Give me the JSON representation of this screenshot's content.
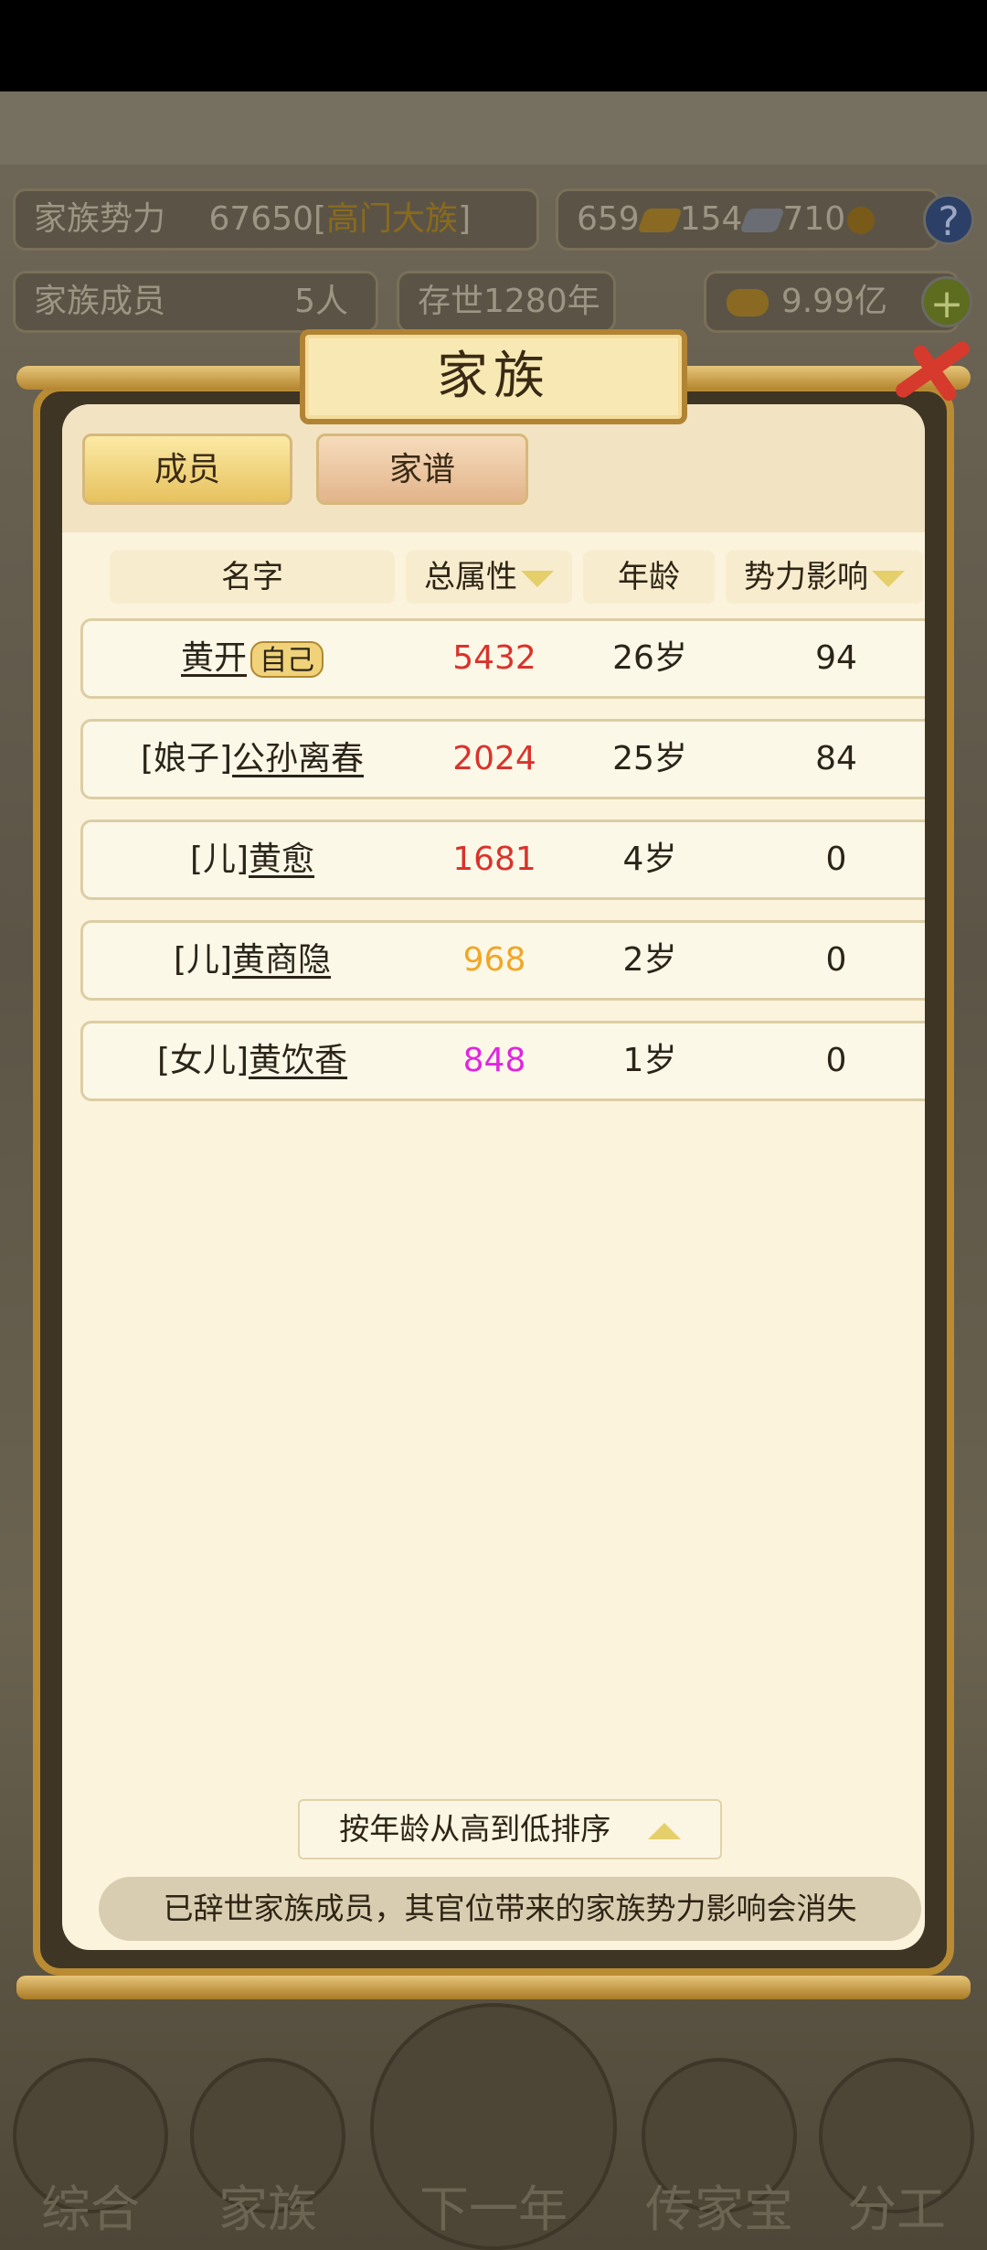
{
  "stats": {
    "power_label": "家族势力",
    "power_value": "67650",
    "power_rank_open": "[",
    "power_rank": "高门大族",
    "power_rank_close": "]",
    "gold": "659",
    "silver": "154",
    "coins": "710",
    "members_label": "家族成员",
    "members_value": "5人",
    "years": "存世1280年",
    "yuanbao": "9.99亿"
  },
  "modal": {
    "title": "家族",
    "tabs": [
      {
        "label": "成员"
      },
      {
        "label": "家谱"
      }
    ],
    "columns": {
      "name": "名字",
      "attr": "总属性",
      "age": "年龄",
      "influence": "势力影响"
    },
    "rows": [
      {
        "prefix": "",
        "name": "黄开",
        "badge": "自己",
        "attr": "5432",
        "attr_color": "#d9332b",
        "age": "26岁",
        "influence": "94"
      },
      {
        "prefix": "[娘子]",
        "name": "公孙离春",
        "badge": "",
        "attr": "2024",
        "attr_color": "#d9332b",
        "age": "25岁",
        "influence": "84"
      },
      {
        "prefix": "[儿]",
        "name": "黄愈",
        "badge": "",
        "attr": "1681",
        "attr_color": "#d9332b",
        "age": "4岁",
        "influence": "0"
      },
      {
        "prefix": "[儿]",
        "name": "黄商隐",
        "badge": "",
        "attr": "968",
        "attr_color": "#f0a727",
        "age": "2岁",
        "influence": "0"
      },
      {
        "prefix": "[女儿]",
        "name": "黄饮香",
        "badge": "",
        "attr": "848",
        "attr_color": "#e026e0",
        "age": "1岁",
        "influence": "0"
      }
    ],
    "sort_label": "按年龄从高到低排序",
    "notice": "已辞世家族成员，其官位带来的家族势力影响会消失"
  },
  "bottom_nav": [
    {
      "label": "综合"
    },
    {
      "label": "家族"
    },
    {
      "label": "下一年"
    },
    {
      "label": "传家宝"
    },
    {
      "label": "分工"
    }
  ]
}
